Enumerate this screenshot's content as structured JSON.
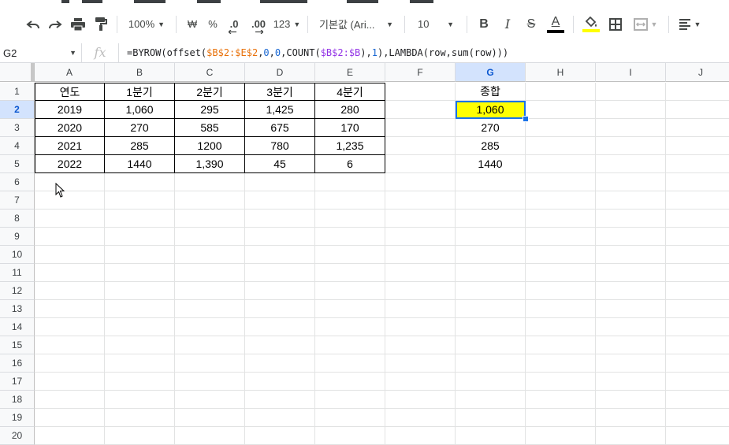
{
  "toolbar": {
    "zoom": "100%",
    "currency": "₩",
    "percent": "%",
    "dec_decrease": ".0",
    "dec_increase": ".00",
    "format_more": "123",
    "font_name": "기본값 (Ari...",
    "font_size": "10",
    "bold": "B",
    "italic": "I",
    "strike": "S",
    "text_color_letter": "A",
    "text_color": "#000000",
    "fill_color": "#ffff00"
  },
  "formula_bar": {
    "cell_ref": "G2",
    "fx": "fx",
    "formula_parts": [
      {
        "text": "=BYROW(offset(",
        "color": "#202124"
      },
      {
        "text": "$B$2:$E$2",
        "color": "#e8710a"
      },
      {
        "text": ",",
        "color": "#202124"
      },
      {
        "text": "0",
        "color": "#1967d2"
      },
      {
        "text": ",",
        "color": "#202124"
      },
      {
        "text": "0",
        "color": "#1967d2"
      },
      {
        "text": ",COUNT(",
        "color": "#202124"
      },
      {
        "text": "$B$2:$B",
        "color": "#9334e6"
      },
      {
        "text": "),",
        "color": "#202124"
      },
      {
        "text": "1",
        "color": "#1967d2"
      },
      {
        "text": "),LAMBDA(row,sum(row)))",
        "color": "#202124"
      }
    ]
  },
  "columns": [
    "A",
    "B",
    "C",
    "D",
    "E",
    "F",
    "G",
    "H",
    "I",
    "J"
  ],
  "rows": [
    "1",
    "2",
    "3",
    "4",
    "5",
    "6",
    "7",
    "8",
    "9",
    "10",
    "11",
    "12",
    "13",
    "14",
    "15",
    "16",
    "17",
    "18",
    "19",
    "20"
  ],
  "table": {
    "headers": [
      "연도",
      "1분기",
      "2분기",
      "3분기",
      "4분기"
    ],
    "rows": [
      [
        "2019",
        "1,060",
        "295",
        "1,425",
        "280"
      ],
      [
        "2020",
        "270",
        "585",
        "675",
        "170"
      ],
      [
        "2021",
        "285",
        "1200",
        "780",
        "1,235"
      ],
      [
        "2022",
        "1440",
        "1,390",
        "45",
        "6"
      ]
    ]
  },
  "summary": {
    "header": "종합",
    "values": [
      "1,060",
      "270",
      "285",
      "1440"
    ],
    "highlight_color": "#ffff00"
  },
  "selected": {
    "column": "G",
    "row": "2"
  }
}
